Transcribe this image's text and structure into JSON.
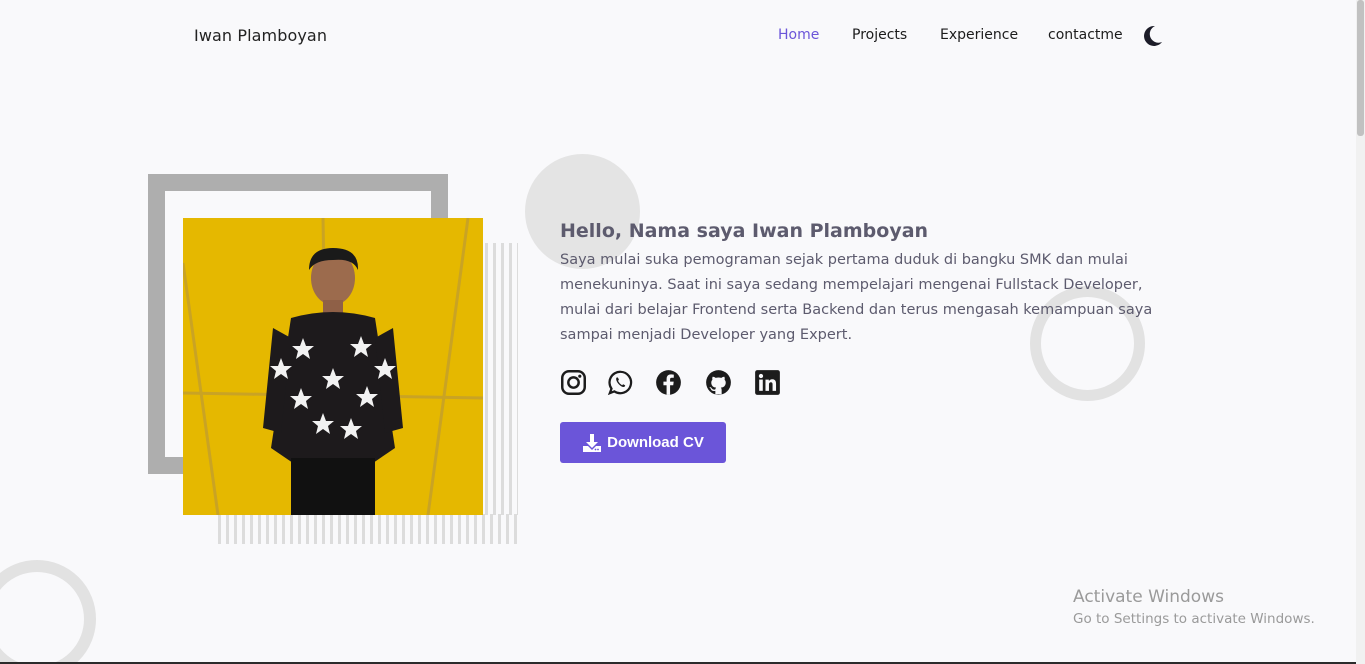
{
  "brand": "Iwan Plamboyan",
  "nav": {
    "items": [
      {
        "label": "Home",
        "active": true
      },
      {
        "label": "Projects",
        "active": false
      },
      {
        "label": "Experience",
        "active": false
      },
      {
        "label": "contactme",
        "active": false
      }
    ],
    "theme_toggle_icon": "moon-icon"
  },
  "hero": {
    "greeting": "Hello, Nama saya Iwan Plamboyan",
    "bio": "Saya mulai suka pemograman sejak pertama duduk di bangku SMK dan mulai menekuninya. Saat ini saya sedang mempelajari mengenai Fullstack Developer, mulai dari belajar Frontend serta Backend dan terus mengasah kemampuan saya sampai menjadi Developer yang Expert.",
    "socials": [
      "instagram-icon",
      "whatsapp-icon",
      "facebook-icon",
      "github-icon",
      "linkedin-icon"
    ],
    "cv_button": "Download CV"
  },
  "watermark": {
    "title": "Activate Windows",
    "subtitle": "Go to Settings to activate Windows."
  },
  "colors": {
    "accent": "#6b55d9",
    "text": "#5d5b6e",
    "background": "#f9f9fb",
    "photo_background": "#e5b800"
  }
}
